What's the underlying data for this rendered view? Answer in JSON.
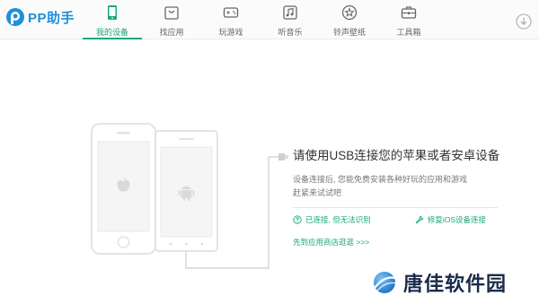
{
  "app": {
    "logo_text": "PP助手"
  },
  "nav": {
    "items": [
      {
        "label": "我的设备",
        "icon": "phone-icon",
        "active": true
      },
      {
        "label": "找应用",
        "icon": "app-bag-icon",
        "active": false
      },
      {
        "label": "玩游戏",
        "icon": "gamepad-icon",
        "active": false
      },
      {
        "label": "听音乐",
        "icon": "music-icon",
        "active": false
      },
      {
        "label": "铃声壁纸",
        "icon": "star-icon",
        "active": false
      },
      {
        "label": "工具箱",
        "icon": "toolbox-icon",
        "active": false
      }
    ]
  },
  "connect": {
    "title": "请使用USB连接您的苹果或者安卓设备",
    "description_line1": "设备连接后, 您能免费安装各种好玩的应用和游戏",
    "description_line2": "赶紧来试试吧",
    "status_connected": "已连接, 但无法识别",
    "status_repair": "修复iOS设备连接",
    "app_store_link": "先到应用商店逛逛 >>>"
  },
  "watermark": {
    "text": "唐佳软件园"
  },
  "colors": {
    "accent": "#18a878",
    "brand": "#1f8fd9",
    "phone_outline": "#e3e3e3"
  }
}
